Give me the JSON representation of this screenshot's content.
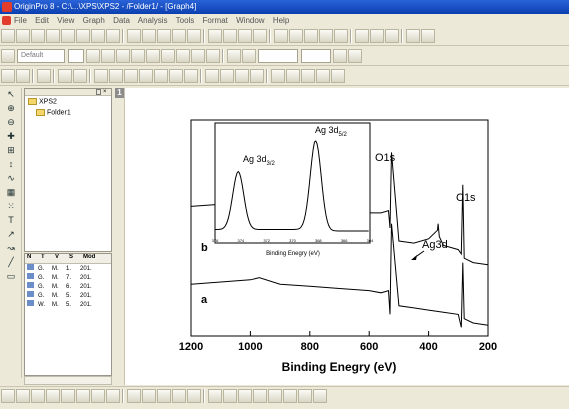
{
  "window": {
    "title": "OriginPro 8 - C:\\...\\XPS\\XPS2 - /Folder1/ - [Graph4]"
  },
  "menu": [
    "File",
    "Edit",
    "View",
    "Graph",
    "Data",
    "Analysis",
    "Tools",
    "Format",
    "Window",
    "Help"
  ],
  "toolbar": {
    "font_combo": "Default"
  },
  "explorer": {
    "root": "XPS2",
    "folder": "Folder1"
  },
  "filelist": {
    "columns": [
      "N",
      "T",
      "V",
      "S",
      "Mod"
    ],
    "rows": [
      [
        "G.",
        "M.",
        "1.",
        "201."
      ],
      [
        "G.",
        "M.",
        "7.",
        "201."
      ],
      [
        "G.",
        "M.",
        "6.",
        "201."
      ],
      [
        "G.",
        "M.",
        "5.",
        "201."
      ],
      [
        "W.",
        "M.",
        "5.",
        "201."
      ]
    ]
  },
  "graph": {
    "page_number": "1"
  },
  "chart_data": {
    "type": "line",
    "xlabel": "Binding Enegry (eV)",
    "xlim": [
      1200,
      200
    ],
    "xticks": [
      1200,
      1000,
      800,
      600,
      400,
      200
    ],
    "series": [
      {
        "name": "a",
        "x": [
          1200,
          1100,
          1000,
          970,
          900,
          800,
          700,
          600,
          560,
          535,
          530,
          525,
          500,
          450,
          400,
          350,
          300,
          290,
          285,
          280,
          250,
          200
        ],
        "y": [
          24,
          25,
          26,
          27,
          24,
          23,
          22,
          21,
          20,
          21,
          10,
          52,
          14,
          13,
          12,
          11,
          10,
          4,
          34,
          8,
          6,
          5
        ]
      },
      {
        "name": "b",
        "x": [
          1200,
          1100,
          1000,
          970,
          900,
          800,
          700,
          600,
          560,
          535,
          530,
          525,
          500,
          450,
          400,
          370,
          368,
          364,
          350,
          300,
          290,
          285,
          280,
          250,
          200
        ],
        "y": [
          60,
          61,
          62,
          64,
          60,
          59,
          58,
          57,
          57,
          58,
          50,
          85,
          44,
          43,
          45,
          49,
          52,
          46,
          42,
          40,
          38,
          70,
          36,
          34,
          33
        ]
      }
    ],
    "annotations": [
      "O1s",
      "C1s",
      "Ag3d"
    ],
    "inset": {
      "xlabel": "Binding Enegry (eV)",
      "xlim": [
        376,
        364
      ],
      "xticks": [
        376,
        374,
        372,
        370,
        368,
        366,
        364
      ],
      "peaks": [
        {
          "label": "Ag 3d",
          "sub": "3/2",
          "x": 374.2
        },
        {
          "label": "Ag 3d",
          "sub": "5/2",
          "x": 368.2
        }
      ]
    }
  }
}
